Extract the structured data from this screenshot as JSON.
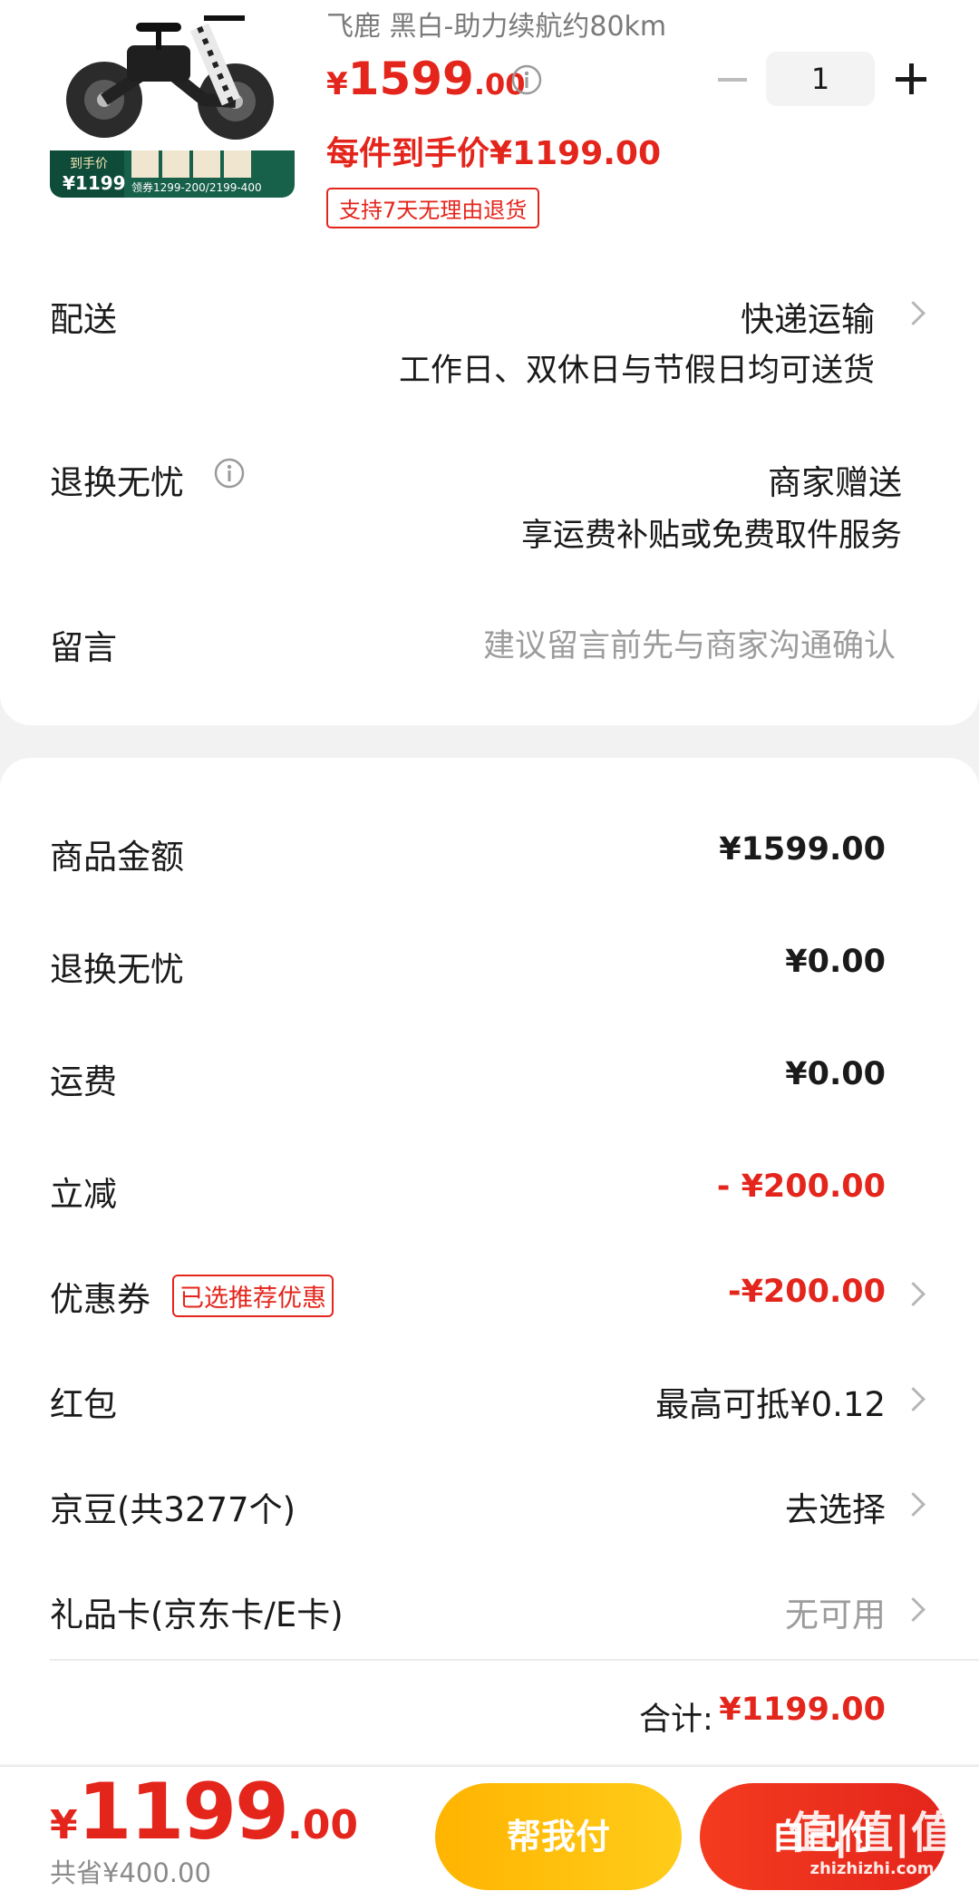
{
  "product": {
    "title": "飞鹿 黑白-助力续航约80km",
    "price_currency": "¥",
    "price_int": "1599",
    "price_dec": ".00",
    "final_price": "每件到手价¥1199.00",
    "return_tag": "支持7天无理由退货",
    "quantity": "1",
    "image_badge_label": "到手价",
    "image_badge_price": "¥1199",
    "image_coupon_text": "领券1299-200/2199-400"
  },
  "delivery": {
    "label": "配送",
    "method": "快递运输",
    "note": "工作日、双休日与节假日均可送货"
  },
  "worry_free": {
    "label": "退换无忧",
    "value": "商家赠送",
    "note": "享运费补贴或免费取件服务"
  },
  "message": {
    "label": "留言",
    "placeholder": "建议留言前先与商家沟通确认"
  },
  "summary": {
    "rows": [
      {
        "label": "商品金额",
        "value": "¥1599.00"
      },
      {
        "label": "退换无忧",
        "value": "¥0.00"
      },
      {
        "label": "运费",
        "value": "¥0.00"
      },
      {
        "label": "立减",
        "value": "- ¥200.00"
      },
      {
        "label": "优惠券",
        "tag": "已选推荐优惠",
        "value": "-¥200.00"
      },
      {
        "label": "红包",
        "value": "最高可抵¥0.12"
      },
      {
        "label": "京豆(共3277个)",
        "value": "去选择"
      },
      {
        "label": "礼品卡(京东卡/E卡)",
        "value": "无可用"
      }
    ],
    "total_label": "合计:",
    "total_value": "¥1199.00"
  },
  "bottom_bar": {
    "price_currency": "¥",
    "price_int": "1199",
    "price_dec": ".00",
    "saved": "共省¥400.00",
    "help_pay": "帮我付",
    "self_pay": "自己付"
  },
  "watermark": {
    "text": "值|值|值",
    "site": "zhizhizhi.com"
  },
  "colors": {
    "accent_red": "#e4251c",
    "button_yellow": "#ffc107",
    "background": "#f2f2f2"
  }
}
